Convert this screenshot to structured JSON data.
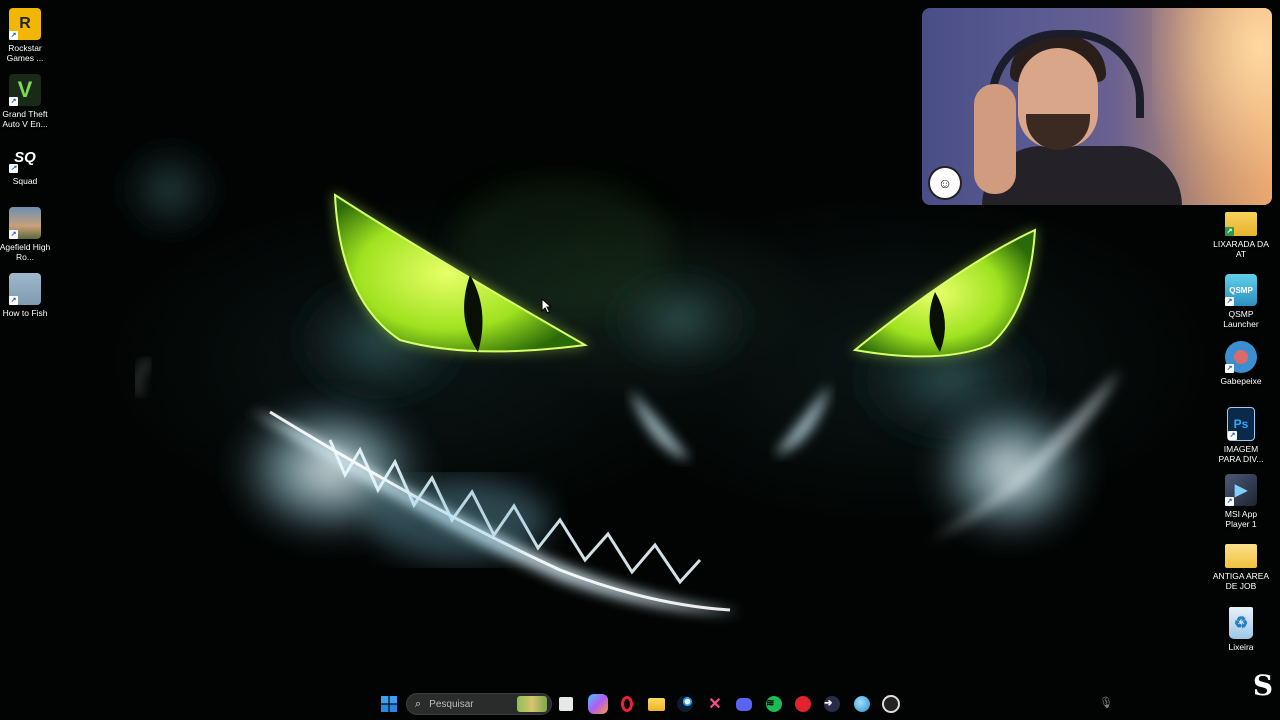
{
  "desktop_icons_left": [
    {
      "label": "Rockstar Games ...",
      "icon": "rockstar-games-icon",
      "color": "#f2b705",
      "glyph": "R"
    },
    {
      "label": "Grand Theft Auto V En...",
      "icon": "gta-v-icon",
      "color": "#2f4a2a",
      "glyph": "V"
    },
    {
      "label": "Squad",
      "icon": "squad-icon",
      "color": "#1a1a1a",
      "glyph": "SQ"
    },
    {
      "label": "Agefield High Ro...",
      "icon": "agefield-icon",
      "color": "#6b7a4a",
      "glyph": ""
    },
    {
      "label": "How to Fish",
      "icon": "how-to-fish-icon",
      "color": "#7f9ab0",
      "glyph": ""
    }
  ],
  "desktop_icons_right": [
    {
      "label": "LIXARADA DA AT",
      "icon": "folder-icon",
      "color": "#f4c542",
      "glyph": ""
    },
    {
      "label": "QSMP Launcher",
      "icon": "qsmp-launcher-icon",
      "color": "#3fa7c9",
      "glyph": "QSMP"
    },
    {
      "label": "Gabepeixe",
      "icon": "gabepeixe-icon",
      "color": "#3b8fd1",
      "glyph": ""
    },
    {
      "label": "IMAGEM PARA DIV...",
      "icon": "photoshop-file-icon",
      "color": "#0b2a4a",
      "glyph": "Ps"
    },
    {
      "label": "MSI App Player 1",
      "icon": "msi-app-player-icon",
      "color": "#2b2b3a",
      "glyph": "▶"
    },
    {
      "label": "ANTIGA AREA DE JOB",
      "icon": "folder-icon",
      "color": "#f4c542",
      "glyph": ""
    },
    {
      "label": "Lixeira",
      "icon": "recycle-bin-icon",
      "color": "#9fc7e6",
      "glyph": "♻"
    }
  ],
  "taskbar": {
    "search_placeholder": "Pesquisar",
    "apps": [
      {
        "name": "start-button",
        "icon": "windows-icon",
        "color": "#2f8cf0",
        "glyph": "⊞"
      },
      {
        "name": "task-view",
        "icon": "task-view-icon",
        "color": "#3a3a3a",
        "glyph": "▣"
      },
      {
        "name": "copilot",
        "icon": "copilot-icon",
        "color": "#6f5cf0",
        "glyph": "◈"
      },
      {
        "name": "opera-gx",
        "icon": "opera-gx-icon",
        "color": "#c8102e",
        "glyph": "O"
      },
      {
        "name": "file-explorer",
        "icon": "folder-icon",
        "color": "#f4c542",
        "glyph": "▬"
      },
      {
        "name": "steam",
        "icon": "steam-icon",
        "color": "#1b2838",
        "glyph": "⚙"
      },
      {
        "name": "capcut",
        "icon": "capcut-icon",
        "color": "#e0306f",
        "glyph": "✕"
      },
      {
        "name": "discord",
        "icon": "discord-icon",
        "color": "#5865f2",
        "glyph": "◉"
      },
      {
        "name": "spotify",
        "icon": "spotify-icon",
        "color": "#1db954",
        "glyph": "≋"
      },
      {
        "name": "recorder",
        "icon": "red-app-icon",
        "color": "#d8262d",
        "glyph": "●"
      },
      {
        "name": "arrow-app",
        "icon": "arrow-app-icon",
        "color": "#3a3a5a",
        "glyph": "➜"
      },
      {
        "name": "browser-globe",
        "icon": "globe-icon",
        "color": "#3aa0d8",
        "glyph": "◐"
      },
      {
        "name": "obs",
        "icon": "obs-icon",
        "color": "#2b2b2b",
        "glyph": "◍"
      }
    ]
  }
}
